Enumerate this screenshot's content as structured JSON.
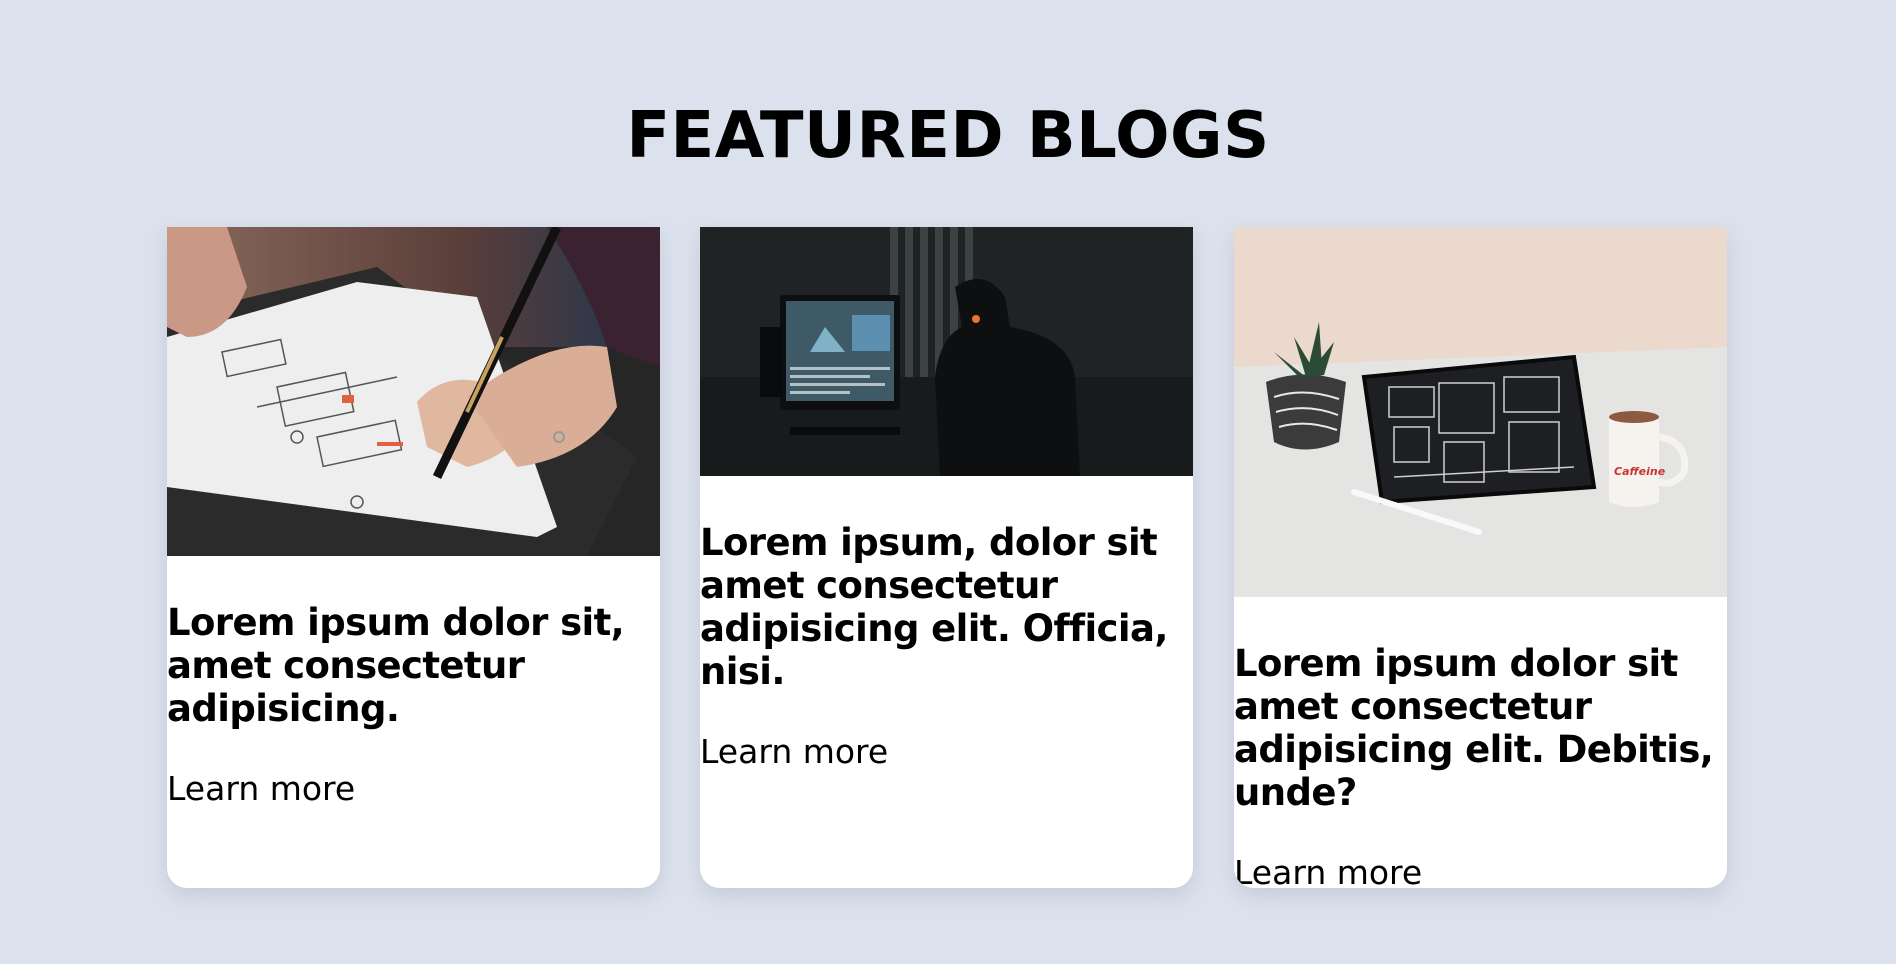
{
  "section": {
    "title": "FEATURED BLOGS"
  },
  "cards": [
    {
      "image": "wireframe-sketching-photo",
      "title": "Lorem ipsum dolor sit, amet consectetur adipisicing.",
      "link": "Learn more"
    },
    {
      "image": "video-editing-desk-photo",
      "title": "Lorem ipsum, dolor sit amet consectetur adipisicing elit. Officia, nisi.",
      "link": "Learn more"
    },
    {
      "image": "tablet-plant-mug-photo",
      "title": "Lorem ipsum dolor sit amet consectetur adipisicing elit. Debitis, unde?",
      "link": "Learn more",
      "mug_text": "Caffeine"
    }
  ],
  "colors": {
    "background": "#dce2ed",
    "card": "#ffffff",
    "text": "#000000"
  }
}
